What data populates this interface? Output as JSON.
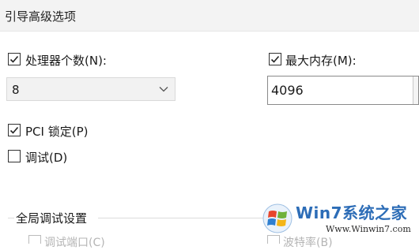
{
  "dialog": {
    "title": "引导高级选项"
  },
  "processor_count": {
    "label": "处理器个数(N):",
    "checked": true,
    "value": "8"
  },
  "max_memory": {
    "label": "最大内存(M):",
    "checked": true,
    "value": "4096"
  },
  "pci_lock": {
    "label": "PCI 锁定(P)",
    "checked": true
  },
  "debug": {
    "label": "调试(D)",
    "checked": false
  },
  "global_debug": {
    "title": "全局调试设置",
    "partial_left": "调试端口(C)",
    "partial_right": "波特率(B)"
  },
  "watermark": {
    "text": "Win7系统之家",
    "url": "Www.Winwin7.com"
  },
  "colors": {
    "accent": "#2d6db7",
    "combo_bg": "#f2f2f2",
    "titlebar_bg": "#f3f3f3"
  }
}
